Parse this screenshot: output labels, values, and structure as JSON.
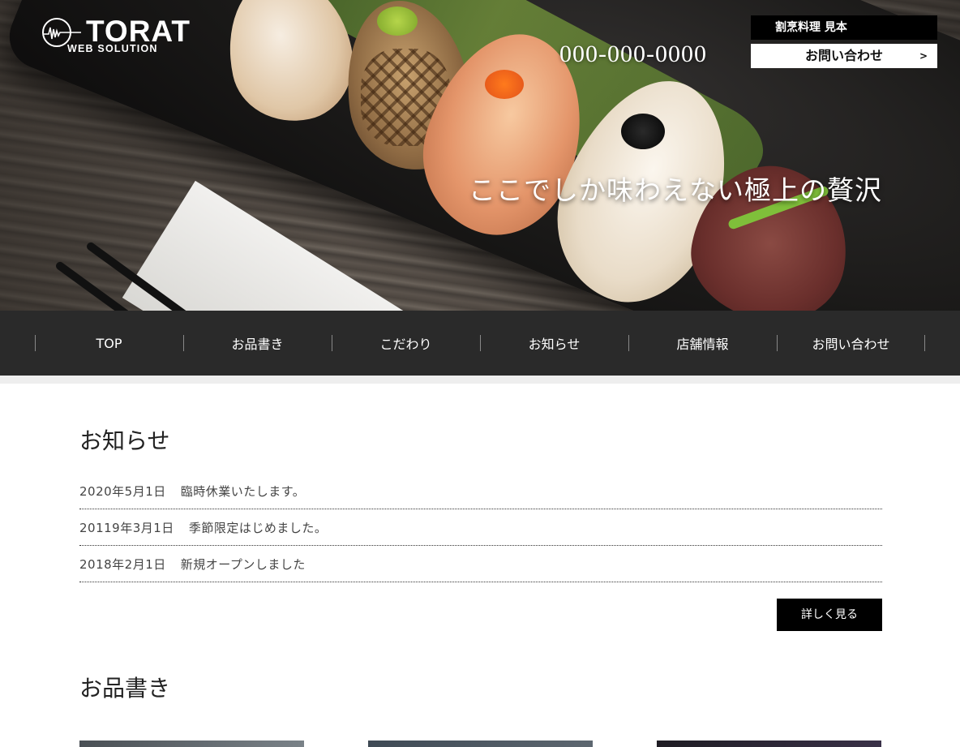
{
  "header": {
    "logo_text": "TORAT",
    "logo_sub": "WEB SOLUTION",
    "phone": "000-000-0000",
    "shop_name": "割烹料理 見本",
    "contact_label": "お問い合わせ",
    "contact_arrow": ">",
    "catchcopy": "ここでしか味わえない極上の贅沢"
  },
  "nav": {
    "items": [
      {
        "label": "TOP"
      },
      {
        "label": "お品書き"
      },
      {
        "label": "こだわり"
      },
      {
        "label": "お知らせ"
      },
      {
        "label": "店舗情報"
      },
      {
        "label": "お問い合わせ"
      }
    ]
  },
  "news": {
    "title": "お知らせ",
    "items": [
      {
        "date": "2020年5月1日",
        "text": "臨時休業いたします。"
      },
      {
        "date": "20119年3月1日",
        "text": "季節限定はじめました。"
      },
      {
        "date": "2018年2月1日",
        "text": "新規オープンしました"
      }
    ],
    "more_label": "詳しく見る"
  },
  "menu": {
    "title": "お品書き"
  },
  "icons": {
    "logo": "signal-wave-logo-icon",
    "arrow": "chevron-right-icon"
  }
}
